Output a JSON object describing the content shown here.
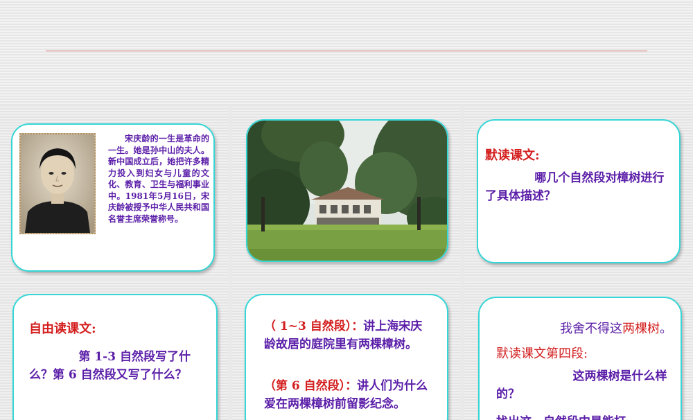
{
  "slide1": {
    "bio": "宋庆龄的一生是革命的一生。她是孙中山的夫人。新中国成立后，她把许多精力投入到妇女与儿童的文化、教育、卫生与福利事业中。1981年5月16日，宋庆龄被授予中华人民共和国名誉主席荣誉称号。"
  },
  "slide3": {
    "heading": "默读课文:",
    "question": "哪几个自然段对樟树进行了具体描述？"
  },
  "slide4": {
    "heading": "自由读课文:",
    "question": "第 1-3 自然段写了什么？第 6 自然段又写了什么？"
  },
  "slide5": {
    "p1_ref": "（ 1~3 自然段）：",
    "p1_text": "讲上海宋庆龄故居的庭院里有两棵樟树。",
    "p2_ref": "（第 6 自然段）：",
    "p2_text": "讲人们为什么爱在两棵樟树前留影纪念。"
  },
  "slide6": {
    "line1_prefix": "我舍不得这",
    "line1_highlight": "两棵树",
    "line1_end": "。",
    "heading": "默读课文第四段:",
    "question": "这两棵树是什么样的？",
    "partial": "找出这一自然段中是能打"
  },
  "colors": {
    "card_border": "#35d6d6",
    "text_purple": "#5b1ea8",
    "text_red": "#d41e1e",
    "divider_red": "#e07b7b"
  }
}
